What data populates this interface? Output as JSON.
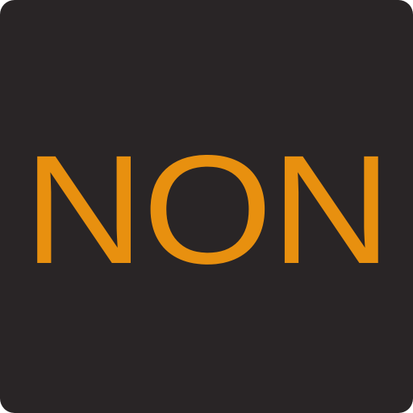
{
  "app_icon": {
    "label": "NON",
    "colors": {
      "background": "#292526",
      "text": "#e8900f"
    }
  }
}
